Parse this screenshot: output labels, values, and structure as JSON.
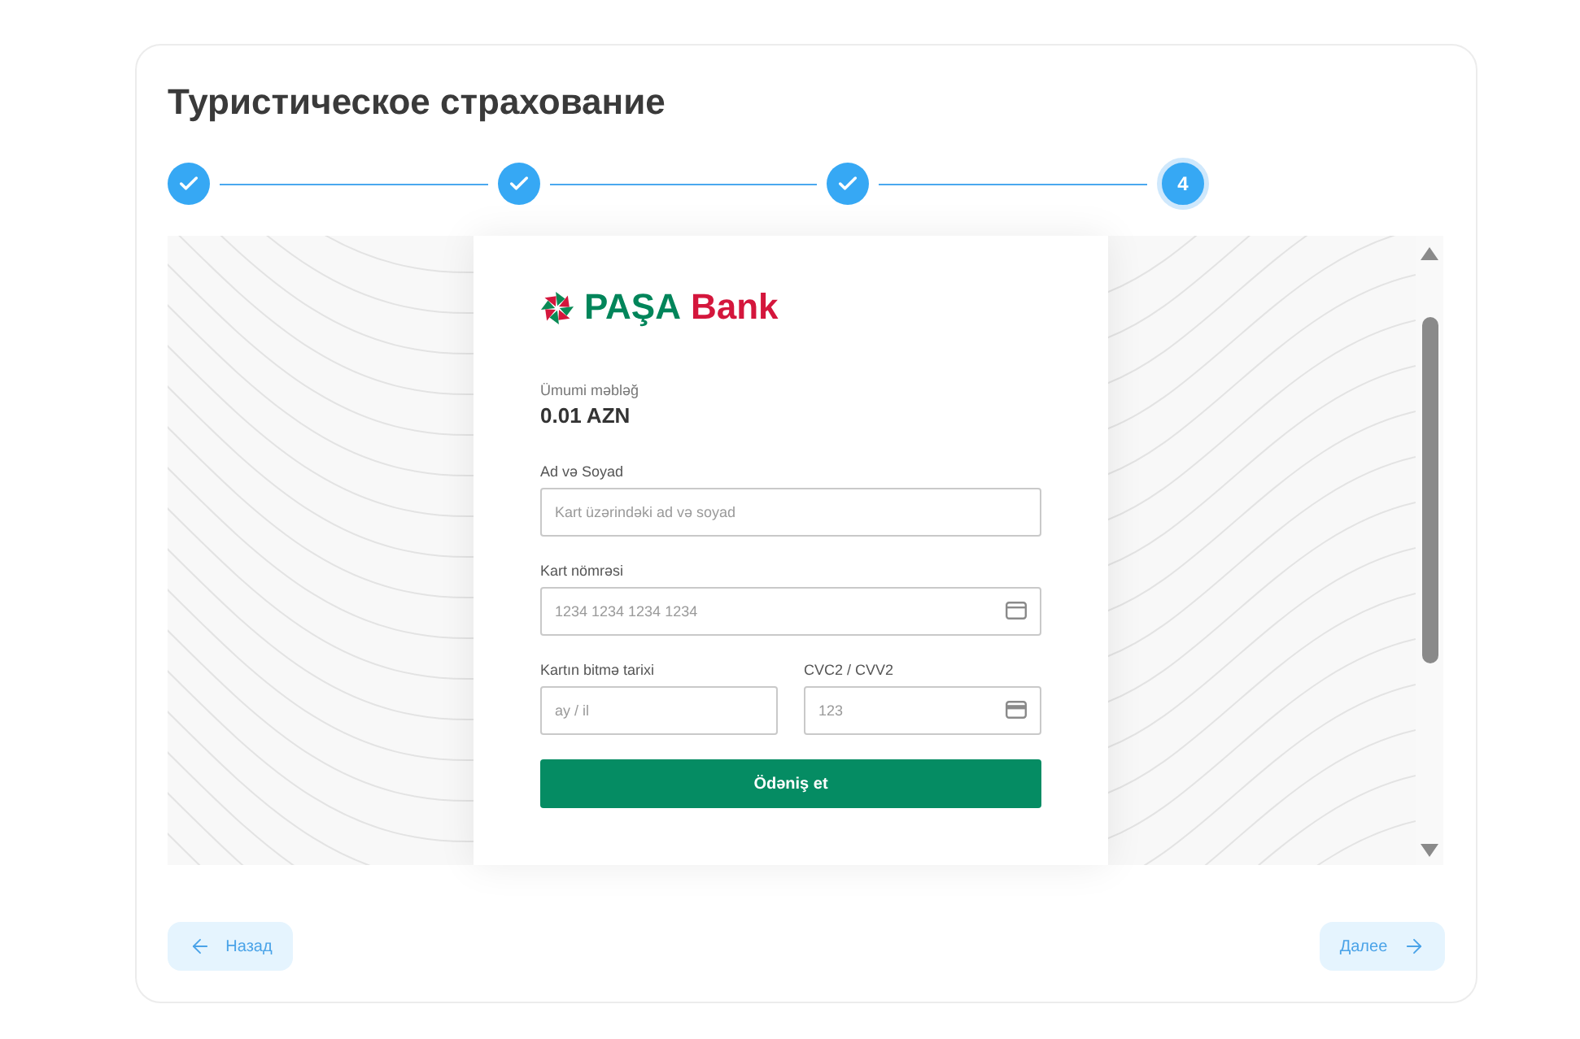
{
  "title": "Туристическое страхование",
  "steps": [
    {
      "completed": true,
      "current": false
    },
    {
      "completed": true,
      "current": false
    },
    {
      "completed": true,
      "current": false
    },
    {
      "number": "4",
      "completed": false,
      "current": true
    }
  ],
  "payment": {
    "brand_name": "PAŞA",
    "brand_suffix": "Bank",
    "total_label": "Ümumi məbləğ",
    "total_amount": "0.01 AZN",
    "rows": [
      {
        "fields": [
          {
            "kind": "name",
            "label": "Ad və Soyad",
            "placeholder": "Kart üzərindəki ad və soyad"
          }
        ]
      },
      {
        "fields": [
          {
            "kind": "number",
            "label": "Kart nömrəsi",
            "placeholder": "1234 1234 1234 1234"
          }
        ]
      },
      {
        "fields": [
          {
            "kind": "expiry",
            "label": "Kartın bitmə tarixi",
            "placeholder": "ay / il"
          },
          {
            "kind": "cvc",
            "label": "CVC2 / CVV2",
            "placeholder": "123"
          }
        ]
      }
    ],
    "pay_button": "Ödəniş et"
  },
  "footer": {
    "back_button": "Назад",
    "next_button": "Далее"
  }
}
